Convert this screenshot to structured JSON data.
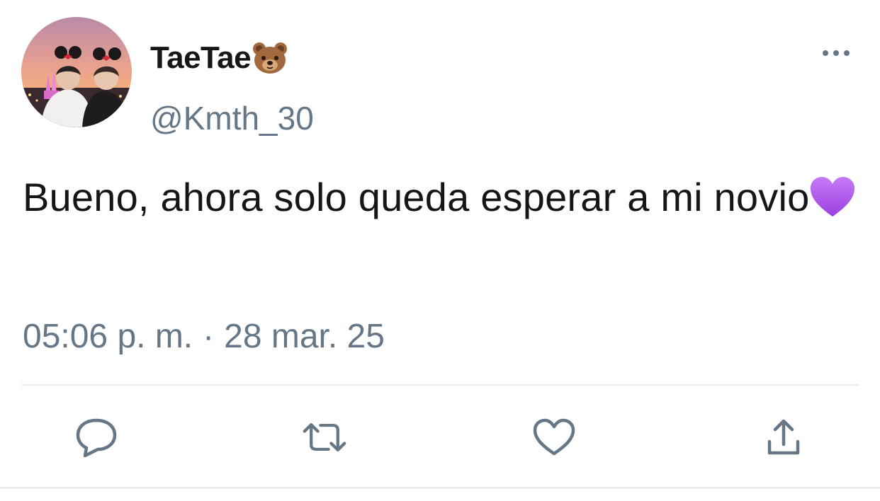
{
  "tweet": {
    "display_name": "TaeTae",
    "name_emoji": "bear-face-emoji",
    "handle": "@Kmth_30",
    "text": "Bueno, ahora solo queda esperar a mi novio",
    "text_emoji": "purple-heart-emoji",
    "time": "05:06 p. m.",
    "separator": "·",
    "date": "28 mar. 25"
  },
  "header": {
    "more_icon": "more-options-icon"
  },
  "actions": [
    {
      "icon": "reply-icon"
    },
    {
      "icon": "retweet-icon"
    },
    {
      "icon": "like-icon"
    },
    {
      "icon": "share-icon"
    }
  ],
  "colors": {
    "text_primary": "#14171a",
    "text_secondary": "#657786",
    "icon_color": "#657786",
    "divider": "#e6ecf0",
    "background": "#ffffff"
  }
}
